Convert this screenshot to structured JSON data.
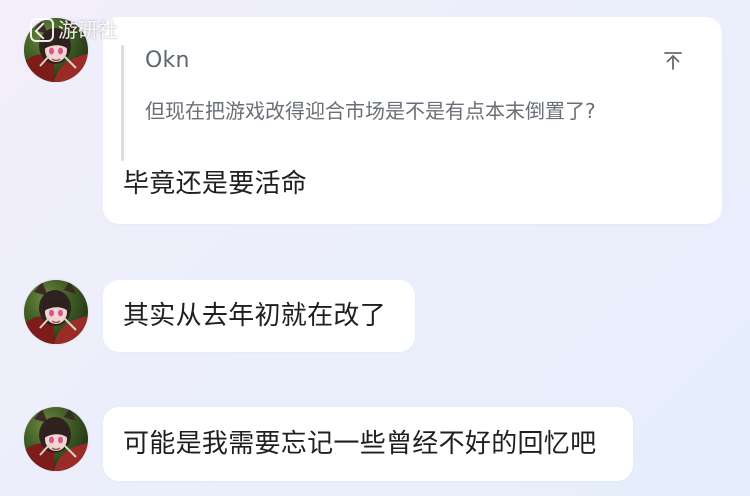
{
  "watermark": {
    "text": "游研社"
  },
  "messages": [
    {
      "quote": {
        "author": "Okn",
        "text": "但现在把游戏改得迎合市场是不是有点本末倒置了?"
      },
      "text": "毕竟还是要活命"
    },
    {
      "text": "其实从去年初就在改了"
    },
    {
      "text": "可能是我需要忘记一些曾经不好的回忆吧"
    }
  ],
  "icons": {
    "quote_jump": "jump-to-top-icon",
    "avatar": "avatar-image"
  }
}
